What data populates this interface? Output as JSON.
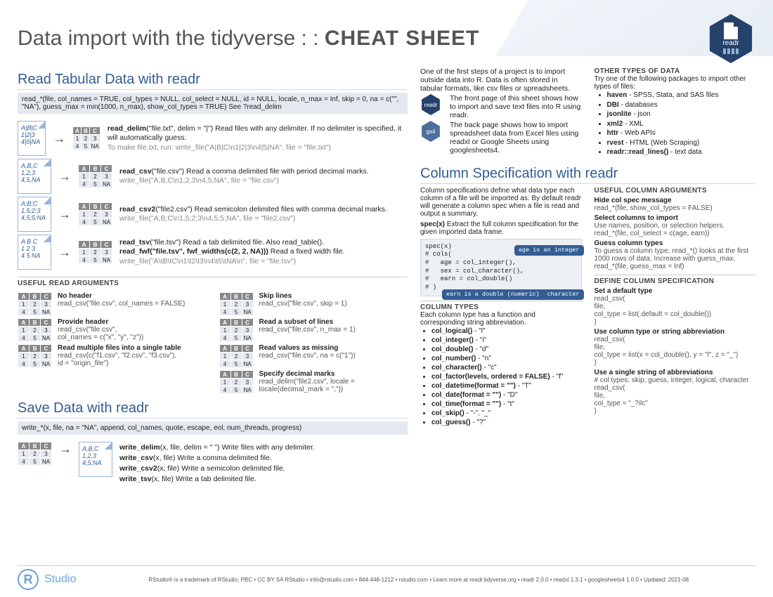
{
  "title_prefix": "Data import with the tidyverse : : ",
  "title_suffix": "CHEAT SHEET",
  "logo_label": "readr",
  "sections": {
    "read": {
      "heading": "Read Tabular Data with readr",
      "signature": "read_*(file, col_names = TRUE, col_types = NULL, col_select = NULL, id = NULL, locale, n_max = Inf, skip = 0, na = c(\"\", \"NA\"), guess_max = min(1000, n_max), show_col_types = TRUE) See ?read_delim",
      "examples": [
        {
          "file": "A|B|C\n1|2|3\n4|5|NA",
          "fn": "read_delim",
          "args": "(\"file.txt\", delim = \"|\")",
          "after": " Read files with any delimiter. If no delimiter is specified, it will automatically guess.",
          "extra": "To make file.txt, run: write_file(\"A|B|C\\n1|2|3\\n4|5|NA\", file = \"file.txt\")"
        },
        {
          "file": "A,B,C\n1,2,3\n4,5,NA",
          "fn": "read_csv",
          "args": "(\"file.csv\")",
          "after": " Read a comma delimited file with period decimal marks.",
          "extra": "write_file(\"A,B,C\\n1,2,3\\n4,5,NA\", file = \"file.csv\")"
        },
        {
          "file": "A;B;C\n1,5;2;3\n4,5;5;NA",
          "fn": "read_csv2",
          "args": "(\"file2.csv\")",
          "after": " Read semicolon delimited files with comma decimal marks.",
          "extra": "write_file(\"A;B;C\\n1,5;2;3\\n4,5;5;NA\", file = \"file2.csv\")"
        },
        {
          "file": "A B C\n1 2 3\n4 5 NA",
          "fn": "read_tsv",
          "args": "(\"file.tsv\")",
          "after": " Read a tab delimited file. Also read_table().",
          "extra2": "read_fwf(\"file.tsv\", fwf_widths(c(2, 2, NA)))",
          "extra2after": " Read a fixed width file.",
          "extra": "write_file(\"A\\tB\\tC\\n1\\t2\\t3\\n4\\t5\\tNA\\n\", file = \"file.tsv\")"
        }
      ],
      "useful_args_heading": "USEFUL READ ARGUMENTS",
      "useful_args_left": [
        {
          "t": "No header",
          "c": "read_csv(\"file.csv\", col_names = FALSE)"
        },
        {
          "t": "Provide header",
          "c": "read_csv(\"file.csv\",\n  col_names = c(\"x\", \"y\", \"z\"))"
        },
        {
          "t": "Read multiple files into a single table",
          "c": "read_csv(c(\"f1.csv\", \"f2.csv\", \"f3.csv\"),\n  id = \"origin_file\")"
        }
      ],
      "useful_args_right": [
        {
          "t": "Skip lines",
          "c": "read_csv(\"file.csv\", skip = 1)"
        },
        {
          "t": "Read a subset of lines",
          "c": "read_csv(\"file.csv\", n_max = 1)"
        },
        {
          "t": "Read values as missing",
          "c": "read_csv(\"file.csv\", na = c(\"1\"))"
        },
        {
          "t": "Specify decimal marks",
          "c": "read_delim(\"file2.csv\", locale =\n  locale(decimal_mark = \",\"))"
        }
      ]
    },
    "save": {
      "heading": "Save Data with readr",
      "signature": "write_*(x, file, na = \"NA\", append, col_names, quote, escape, eol, num_threads, progress)",
      "file_out": "A,B,C\n1,2,3\n4,5,NA",
      "fns": [
        {
          "f": "write_delim",
          "a": "(x, file, delim = \" \")",
          "d": " Write files with any delimiter."
        },
        {
          "f": "write_csv",
          "a": "(x, file)",
          "d": " Write a comma delimited file."
        },
        {
          "f": "write_csv2",
          "a": "(x, file)",
          "d": " Write a semicolon delimited file."
        },
        {
          "f": "write_tsv",
          "a": "(x, file)",
          "d": " Write a tab delimited file."
        }
      ]
    },
    "intro": {
      "p1": "One of the first steps of a project is to import outside data into R. Data is often stored in tabular formats, like csv files or spreadsheets.",
      "readr_desc": "The front page of this sheet shows how to import and save text files into R using readr.",
      "gs_desc": "The back page shows how to import spreadsheet data from Excel files using readxl or Google Sheets using googlesheets4."
    },
    "other_types": {
      "heading": "OTHER TYPES OF DATA",
      "sub": "Try one of the following packages to import other types of files:",
      "items": [
        {
          "b": "haven",
          "d": " - SPSS, Stata, and SAS files"
        },
        {
          "b": "DBI",
          "d": " - databases"
        },
        {
          "b": "jsonlite",
          "d": " - json"
        },
        {
          "b": "xml2",
          "d": " - XML"
        },
        {
          "b": "httr",
          "d": " - Web APIs"
        },
        {
          "b": "rvest",
          "d": " - HTML (Web Scraping)"
        },
        {
          "b": "readr::read_lines()",
          "d": " - text data"
        }
      ]
    },
    "colspec": {
      "heading": "Column Specification with readr",
      "p1": "Column specifications define what data type each column of a file will be imported as. By default readr will generate a column spec when a file is read and output a summary.",
      "p2": "spec(x) Extract the full column specification for the given imported data frame.",
      "code": "spec(x)\n# cols(\n#   age = col_integer(),\n#   sex = col_character(),\n#   earn = col_double()\n# )",
      "callout1": "age is an integer",
      "callout2": "sex is a character",
      "callout3": "earn is a double (numeric)",
      "useful_heading": "USEFUL COLUMN ARGUMENTS",
      "useful_items": [
        {
          "t": "Hide col spec message",
          "c": "read_*(file, show_col_types = FALSE)"
        },
        {
          "t": "Select columns to import",
          "c": "Use names, position, or selection helpers.\nread_*(file, col_select = c(age, earn))"
        },
        {
          "t": "Guess column types",
          "c": "To guess a column type, read_*() looks at the first 1000 rows of data. Increase with guess_max.\nread_*(file, guess_max = Inf)"
        }
      ],
      "types_heading": "COLUMN TYPES",
      "types_sub": "Each column type has a function and corresponding string abbreviation.",
      "types": [
        "col_logical() - \"l\"",
        "col_integer() - \"i\"",
        "col_double() - \"d\"",
        "col_number() - \"n\"",
        "col_character() - \"c\"",
        "col_factor(levels, ordered = FALSE) - \"f\"",
        "col_datetime(format = \"\") - \"T\"",
        "col_date(format = \"\") - \"D\"",
        "col_time(format = \"\") - \"t\"",
        "col_skip() - \"-\", \"_\"",
        "col_guess() - \"?\""
      ],
      "define_heading": "DEFINE COLUMN SPECIFICATION",
      "define_items": [
        {
          "t": "Set a default type",
          "c": "read_csv(\n  file,\n  col_type = list(.default = col_double())\n)"
        },
        {
          "t": "Use column type or string abbreviation",
          "c": "read_csv(\n  file,\n  col_type = list(x = col_double(), y = \"l\", z = \"_\")\n)"
        },
        {
          "t": "Use a single string of abbreviations",
          "c": "# col types: skip, guess, integer, logical, character\nread_csv(\n  file,\n  col_type = \"_?ilc\"\n)"
        }
      ]
    }
  },
  "footer": {
    "brand": "Studio",
    "text": "RStudio® is a trademark of RStudio, PBC • CC BY SA RStudio • info@rstudio.com • 844-448-1212 • rstudio.com • Learn more at readr.tidyverse.org • readr 2.0.0 • readxl 1.3.1 • googlesheets4 1.0.0 • Updated: 2021-08"
  }
}
